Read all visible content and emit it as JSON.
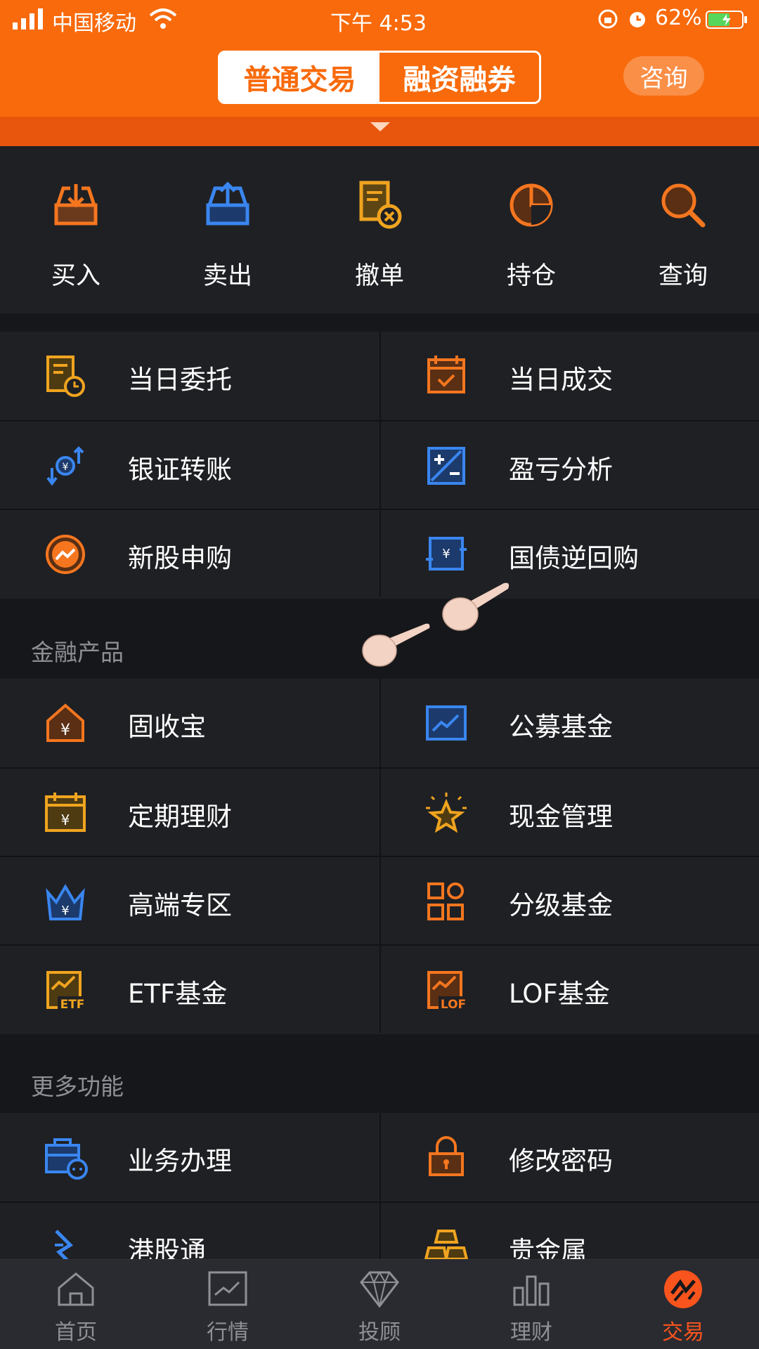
{
  "status": {
    "carrier": "中国移动",
    "time": "下午 4:53",
    "battery": "62%"
  },
  "header": {
    "seg_active": "普通交易",
    "seg_inactive": "融资融券",
    "consult": "咨询"
  },
  "quick": [
    {
      "label": "买入",
      "icon": "tray-in-icon",
      "color": "#f5761f"
    },
    {
      "label": "卖出",
      "icon": "tray-out-icon",
      "color": "#3a86f0"
    },
    {
      "label": "撤单",
      "icon": "cancel-order-icon",
      "color": "#f0a41f"
    },
    {
      "label": "持仓",
      "icon": "pie-icon",
      "color": "#f5761f"
    },
    {
      "label": "查询",
      "icon": "search-icon",
      "color": "#f5761f"
    }
  ],
  "trade_grid": [
    [
      "当日委托",
      "当日成交"
    ],
    [
      "银证转账",
      "盈亏分析"
    ],
    [
      "新股申购",
      "国债逆回购"
    ]
  ],
  "finance": {
    "title": "金融产品",
    "grid": [
      [
        "固收宝",
        "公募基金"
      ],
      [
        "定期理财",
        "现金管理"
      ],
      [
        "高端专区",
        "分级基金"
      ],
      [
        "ETF基金",
        "LOF基金"
      ]
    ]
  },
  "more": {
    "title": "更多功能",
    "grid": [
      [
        "业务办理",
        "修改密码"
      ],
      [
        "港股通",
        "贵金属"
      ]
    ]
  },
  "tabs": [
    {
      "label": "首页",
      "icon": "home-icon"
    },
    {
      "label": "行情",
      "icon": "chart-icon"
    },
    {
      "label": "投顾",
      "icon": "diamond-icon"
    },
    {
      "label": "理财",
      "icon": "bars-icon"
    },
    {
      "label": "交易",
      "icon": "trade-icon"
    }
  ],
  "colors": {
    "brand": "#f86a0b",
    "active_tab": "#f9541d",
    "blue": "#3a86f0",
    "gold": "#f0a41f"
  }
}
